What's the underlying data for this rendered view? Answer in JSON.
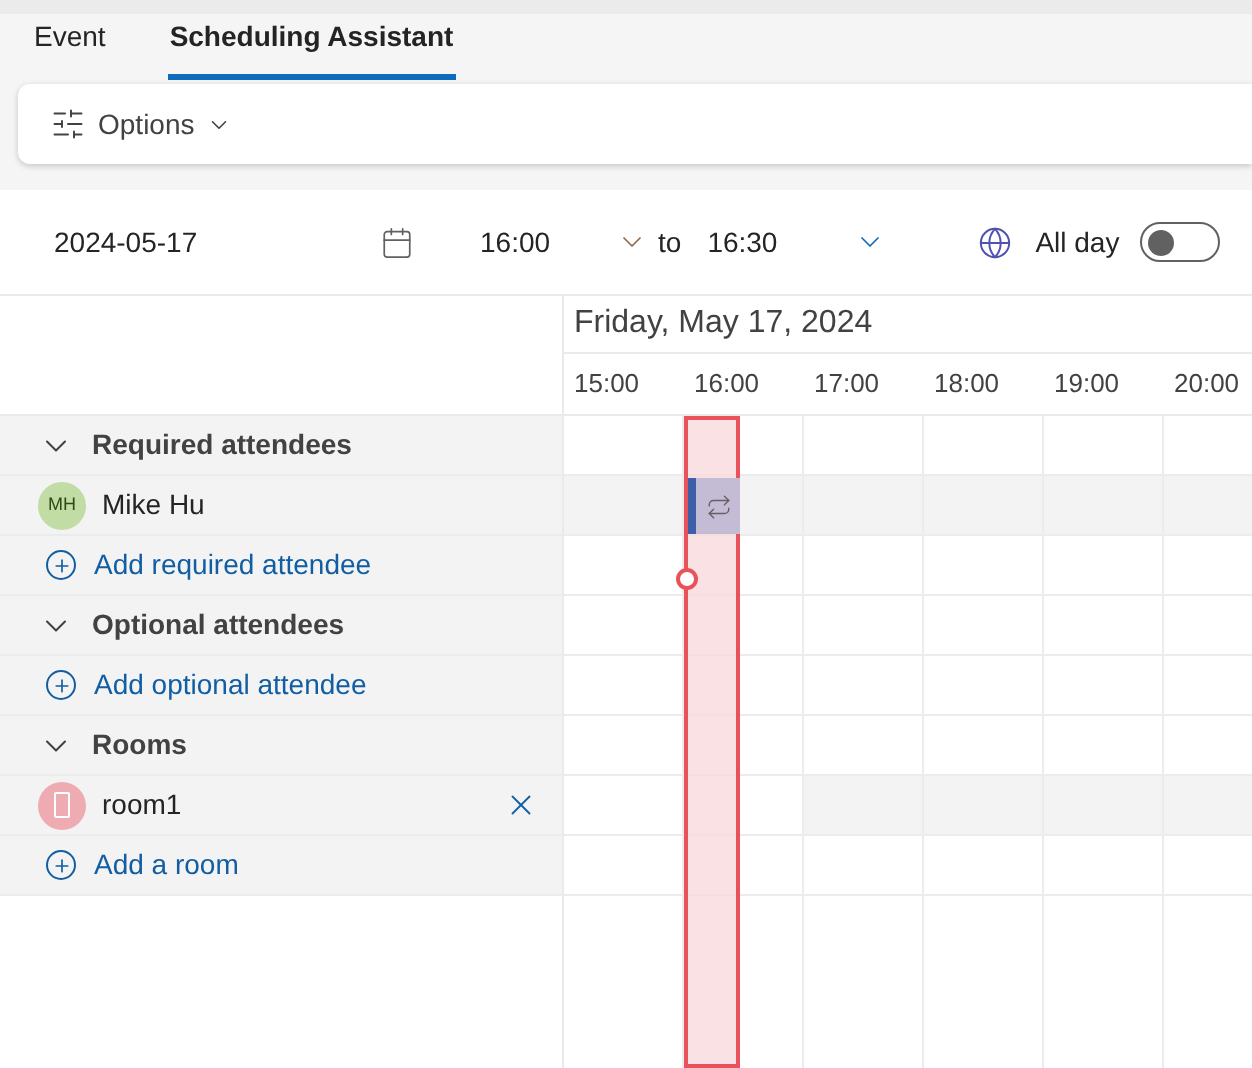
{
  "tabs": [
    {
      "label": "Event",
      "selected": false
    },
    {
      "label": "Scheduling Assistant",
      "selected": true
    }
  ],
  "options_button": {
    "label": "Options"
  },
  "date_row": {
    "date": "2024-05-17",
    "start": "16:00",
    "to": "to",
    "end": "16:30",
    "all_day": {
      "label": "All day",
      "on": false
    }
  },
  "schedule": {
    "day_title": "Friday, May 17, 2024",
    "hours": [
      "15:00",
      "16:00",
      "17:00",
      "18:00",
      "19:00",
      "20:00"
    ],
    "rows": [
      {
        "kind": "group",
        "label": "Required attendees",
        "expanded": true
      },
      {
        "kind": "person",
        "initials": "MH",
        "label": "Mike Hu"
      },
      {
        "kind": "add",
        "label": "Add required attendee"
      },
      {
        "kind": "group",
        "label": "Optional attendees",
        "expanded": true
      },
      {
        "kind": "add",
        "label": "Add optional attendee"
      },
      {
        "kind": "group",
        "label": "Rooms",
        "expanded": true
      },
      {
        "kind": "room",
        "label": "room1"
      },
      {
        "kind": "add",
        "label": "Add a room"
      }
    ]
  }
}
